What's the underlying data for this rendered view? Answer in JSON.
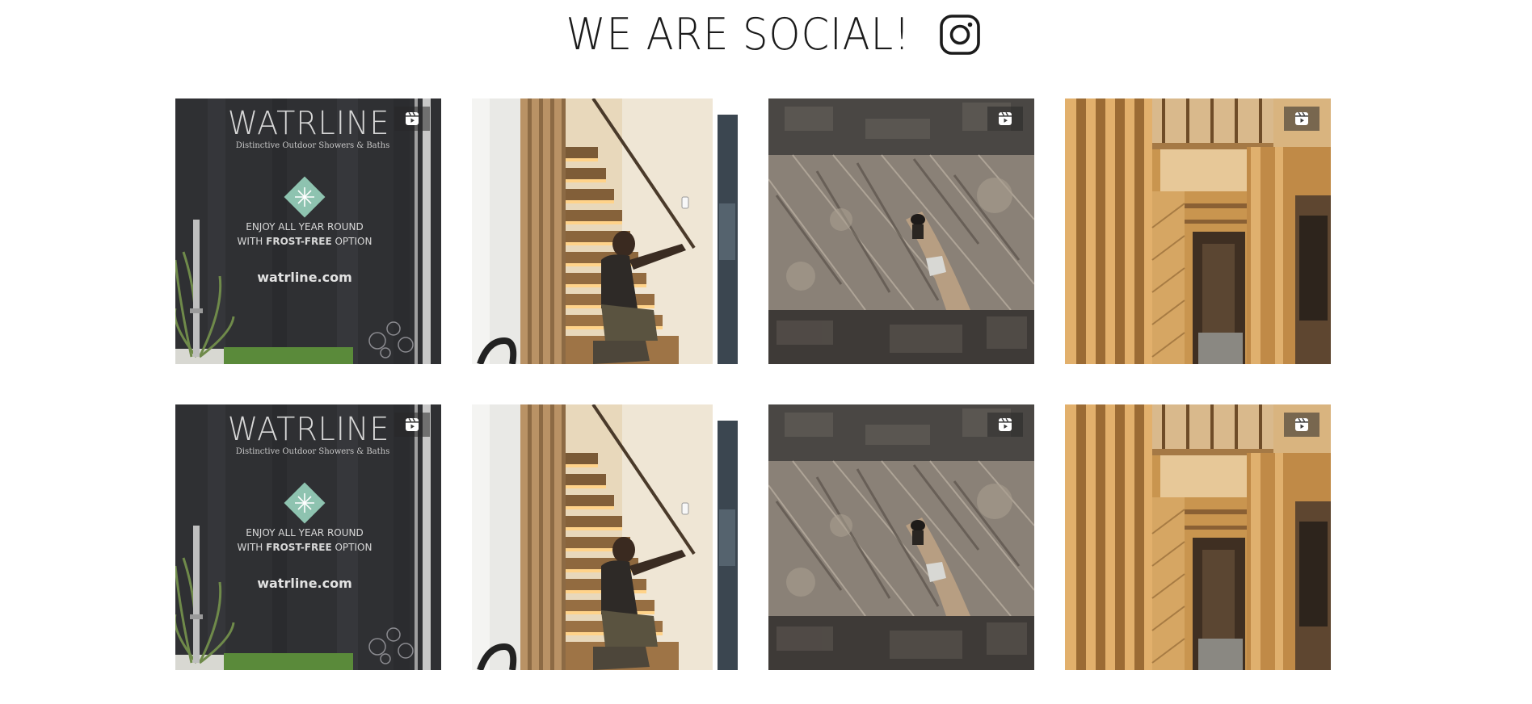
{
  "header": {
    "title": "WE ARE SOCIAL!",
    "icon": "instagram-icon"
  },
  "colors": {
    "title": "#1b1b1b",
    "sign_bg": "#2f3033",
    "sign_accent": "#8ec3b0",
    "wood": "#c9954f"
  },
  "posts": [
    {
      "kind": "watrline-sign",
      "icon": "reel-icon",
      "brand": "WATRLINE",
      "tagline": "Distinctive Outdoor Showers & Baths",
      "line1": "ENJOY ALL YEAR ROUND",
      "line2_prefix": "WITH ",
      "line2_bold": "FROST-FREE",
      "line2_suffix": " OPTION",
      "url": "watrline.com"
    },
    {
      "kind": "staircase",
      "icon": null
    },
    {
      "kind": "aerial-forest",
      "icon": "reel-icon"
    },
    {
      "kind": "framing",
      "icon": "reel-icon"
    },
    {
      "kind": "watrline-sign",
      "icon": "reel-icon",
      "brand": "WATRLINE",
      "tagline": "Distinctive Outdoor Showers & Baths",
      "line1": "ENJOY ALL YEAR ROUND",
      "line2_prefix": "WITH ",
      "line2_bold": "FROST-FREE",
      "line2_suffix": " OPTION",
      "url": "watrline.com"
    },
    {
      "kind": "staircase",
      "icon": null
    },
    {
      "kind": "aerial-forest",
      "icon": "reel-icon"
    },
    {
      "kind": "framing",
      "icon": "reel-icon"
    }
  ]
}
